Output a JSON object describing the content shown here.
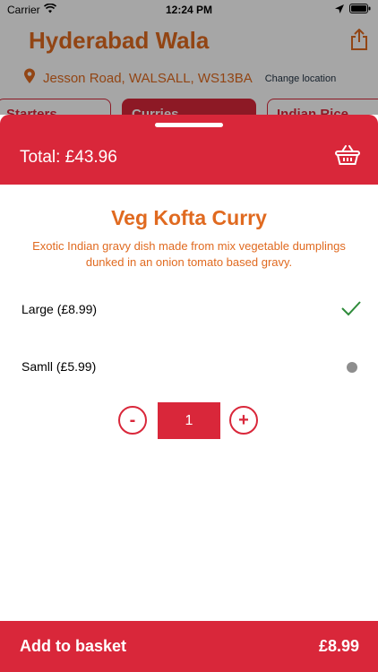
{
  "status": {
    "carrier": "Carrier",
    "time": "12:24 PM"
  },
  "restaurant": {
    "name": "Hyderabad Wala",
    "address": "Jesson Road, WALSALL, WS13BA",
    "change_location": "Change location"
  },
  "categories": [
    {
      "label": "Starters"
    },
    {
      "label": "Curries"
    },
    {
      "label": "Indian Rice"
    }
  ],
  "sheet": {
    "total": "Total: £43.96"
  },
  "item": {
    "name": "Veg Kofta Curry",
    "description": "Exotic Indian gravy dish made from mix vegetable dumplings dunked in an onion tomato based gravy."
  },
  "options": [
    {
      "label": "Large (£8.99)",
      "selected": true
    },
    {
      "label": "Samll (£5.99)",
      "selected": false
    }
  ],
  "stepper": {
    "minus": "-",
    "quantity": "1",
    "plus": "+"
  },
  "footer": {
    "add_label": "Add to basket",
    "price": "£8.99"
  },
  "colors": {
    "brand_red": "#d9273a",
    "accent_orange": "#e06a20"
  }
}
